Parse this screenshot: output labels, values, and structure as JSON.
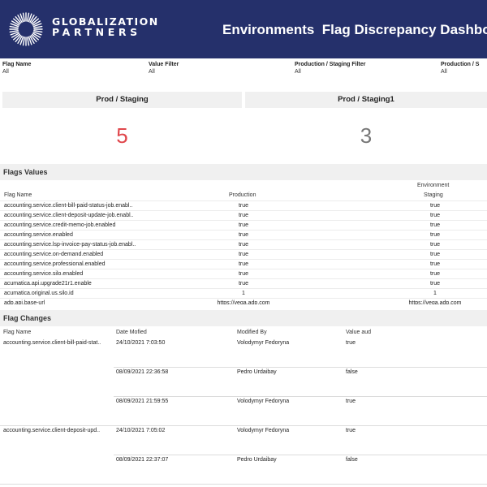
{
  "header": {
    "logo_line1": "GLOBALIZATION",
    "logo_line2": "PARTNERS",
    "title": "Environments  Flag Discrepancy Dashbo",
    "background": "#25306b"
  },
  "filters": [
    {
      "label": "Flag Name",
      "value": "All"
    },
    {
      "label": "Value Filter",
      "value": "All"
    },
    {
      "label": "Production / Staging Filter",
      "value": "All"
    },
    {
      "label": "Production / S",
      "value": "All"
    }
  ],
  "kpis": [
    {
      "title": "Prod / Staging",
      "value": "5",
      "color": "#e0474c"
    },
    {
      "title": "Prod / Staging1",
      "value": "3",
      "color": "#777777"
    }
  ],
  "flags_values": {
    "title": "Flags Values",
    "col_flag": "Flag Name",
    "col_production": "Production",
    "col_env_group": "Environment",
    "col_staging": "Staging",
    "rows": [
      {
        "name": "accounting.service.client-bill-paid-status-job.enabl..",
        "production": "true",
        "staging": "true"
      },
      {
        "name": "accounting.service.client-deposit-update-job.enabl..",
        "production": "true",
        "staging": "true"
      },
      {
        "name": "accounting.service.credit-memo-job.enabled",
        "production": "true",
        "staging": "true"
      },
      {
        "name": "accounting.service.enabled",
        "production": "true",
        "staging": "true"
      },
      {
        "name": "accounting.service.lsp-invoice-pay-status-job.enabl..",
        "production": "true",
        "staging": "true"
      },
      {
        "name": "accounting.service.on-demand.enabled",
        "production": "true",
        "staging": "true"
      },
      {
        "name": "accounting.service.professional.enabled",
        "production": "true",
        "staging": "true"
      },
      {
        "name": "accounting.service.silo.enabled",
        "production": "true",
        "staging": "true"
      },
      {
        "name": "acumatica.api.upgrade21r1.enable",
        "production": "true",
        "staging": "true"
      },
      {
        "name": "acumatica.original.us.silo.id",
        "production": "1",
        "staging": "1"
      },
      {
        "name": "adp.api.base-url",
        "production": "https://vega.adp.com",
        "staging": "https://vega.adp.com"
      }
    ]
  },
  "flag_changes": {
    "title": "Flag Changes",
    "col_flag": "Flag Name",
    "col_date": "Date Mofied",
    "col_modified_by": "Modified By",
    "col_value": "Value aud",
    "groups": [
      {
        "name": "accounting.service.client-bill-paid-stat..",
        "entries": [
          {
            "date": "24/10/2021 7:03:50",
            "by": "Volodymyr Fedoryna",
            "value": "true"
          },
          {
            "date": "08/09/2021 22:36:58",
            "by": "Pedro Urdaibay",
            "value": "false"
          },
          {
            "date": "08/09/2021 21:59:55",
            "by": "Volodymyr Fedoryna",
            "value": "true"
          }
        ]
      },
      {
        "name": "accounting.service.client-deposit-upd..",
        "entries": [
          {
            "date": "24/10/2021 7:05:02",
            "by": "Volodymyr Fedoryna",
            "value": "true"
          },
          {
            "date": "08/09/2021 22:37:07",
            "by": "Pedro Urdaibay",
            "value": "false"
          }
        ]
      }
    ]
  }
}
